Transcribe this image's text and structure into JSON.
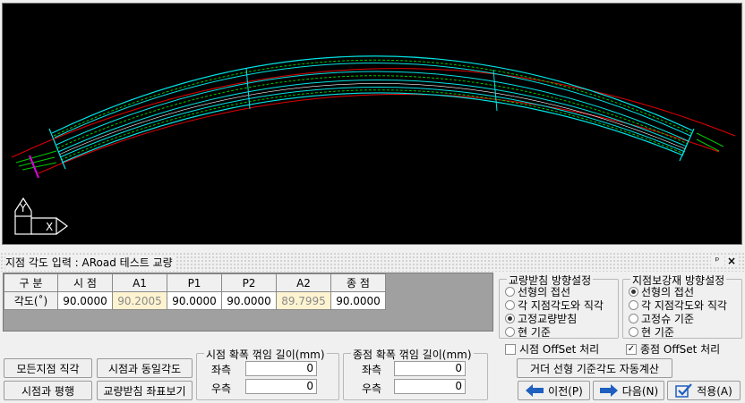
{
  "panel": {
    "title": "지점 각도 입력 : ARoad 테스트 교량",
    "pin_glyph": "ᵖ",
    "close_glyph": "×"
  },
  "grid": {
    "headers": [
      "구  분",
      "시 점",
      "A1",
      "P1",
      "P2",
      "A2",
      "종 점"
    ],
    "row_label": "각도(˚)",
    "values": [
      "90.0000",
      "90.2005",
      "90.0000",
      "90.0000",
      "89.7995",
      "90.0000"
    ]
  },
  "bearing_group": {
    "title": "교량받침 방향설정",
    "options": [
      "선형의 접선",
      "각 지점각도와 직각",
      "고정교량받침",
      "현 기준"
    ],
    "selected": 2
  },
  "support_group": {
    "title": "지점보강재 방향설정",
    "options": [
      "선형의 접선",
      "각 지점각도와 직각",
      "고정슈 기준",
      "현 기준"
    ],
    "selected": 0
  },
  "offset": {
    "start_label": "시점 OffSet 처리",
    "start_checked": false,
    "end_label": "종점 OffSet 처리",
    "end_checked": true,
    "check_glyph": "✓"
  },
  "buttons": {
    "all_right_angle": "모든지점 직각",
    "same_as_start": "시점과 동일각도",
    "parallel_start": "시점과 평행",
    "bearing_coords": "교량받침 좌표보기",
    "auto_calc": "거더 선형 기준각도 자동계산",
    "prev": "이전(P)",
    "next": "다음(N)",
    "apply": "적용(A)"
  },
  "start_widen": {
    "title": "시점 확폭 꺾임 길이(mm)",
    "left_label": "좌측",
    "left_value": "0",
    "right_label": "우측",
    "right_value": "0"
  },
  "end_widen": {
    "title": "종점 확폭 꺾임 길이(mm)",
    "left_label": "좌측",
    "left_value": "0",
    "right_label": "우측",
    "right_value": "0"
  },
  "viewport": {
    "axis_y": "Y",
    "axis_x": "X",
    "colors": {
      "background": "#000000",
      "cyan": "#00e5e5",
      "green": "#00c800",
      "red": "#e00000",
      "white": "#ffffff",
      "magenta": "#e000e0"
    }
  }
}
